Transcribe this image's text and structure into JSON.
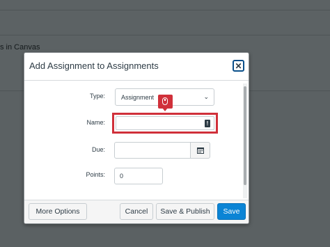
{
  "background": {
    "partial_text": "s in Canvas"
  },
  "modal": {
    "title": "Add Assignment to Assignments",
    "close_label": "✕"
  },
  "form": {
    "type_label": "Type:",
    "type_value": "Assignment",
    "name_label": "Name:",
    "name_value": "",
    "due_label": "Due:",
    "due_value": "",
    "points_label": "Points:",
    "points_value": "0"
  },
  "footer": {
    "more_options": "More Options",
    "cancel": "Cancel",
    "save_publish": "Save & Publish",
    "save": "Save"
  },
  "colors": {
    "highlight": "#d0303a",
    "primary": "#0b84d5"
  },
  "icons": [
    "close-icon",
    "chevron-down-icon",
    "mouse-click-icon",
    "warning-icon",
    "calendar-icon"
  ]
}
